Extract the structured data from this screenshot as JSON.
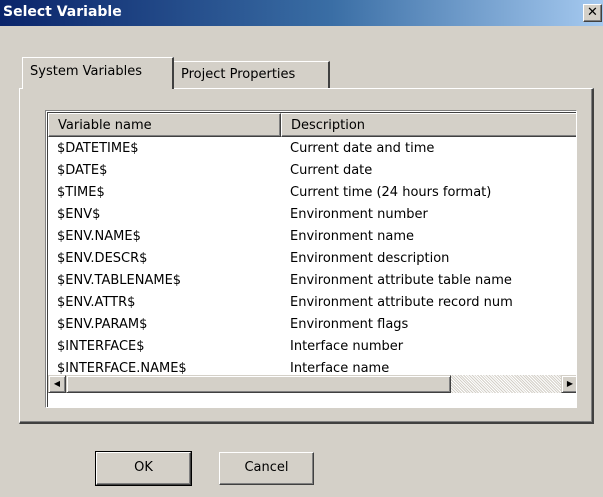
{
  "window": {
    "title": "Select Variable",
    "close_label": "✕"
  },
  "tabs": [
    {
      "label": "System Variables",
      "active": true
    },
    {
      "label": "Project Properties",
      "active": false
    }
  ],
  "list": {
    "columns": [
      "Variable name",
      "Description"
    ],
    "rows": [
      {
        "name": "$DATETIME$",
        "description": "Current date and time"
      },
      {
        "name": "$DATE$",
        "description": "Current date"
      },
      {
        "name": "$TIME$",
        "description": "Current time (24 hours format)"
      },
      {
        "name": "$ENV$",
        "description": "Environment number"
      },
      {
        "name": "$ENV.NAME$",
        "description": "Environment name"
      },
      {
        "name": "$ENV.DESCR$",
        "description": "Environment description"
      },
      {
        "name": "$ENV.TABLENAME$",
        "description": "Environment attribute table name"
      },
      {
        "name": "$ENV.ATTR$",
        "description": "Environment attribute record num"
      },
      {
        "name": "$ENV.PARAM$",
        "description": "Environment flags"
      },
      {
        "name": "$INTERFACE$",
        "description": "Interface number"
      },
      {
        "name": "$INTERFACE.NAME$",
        "description": "Interface name"
      }
    ]
  },
  "scrollbar_glyphs": {
    "up": "▲",
    "down": "▼",
    "left": "◀",
    "right": "▶"
  },
  "buttons": {
    "ok": "OK",
    "cancel": "Cancel"
  },
  "colors": {
    "title_gradient_start": "#0a246a",
    "title_gradient_end": "#a6caf0",
    "face": "#d4d0c8"
  }
}
